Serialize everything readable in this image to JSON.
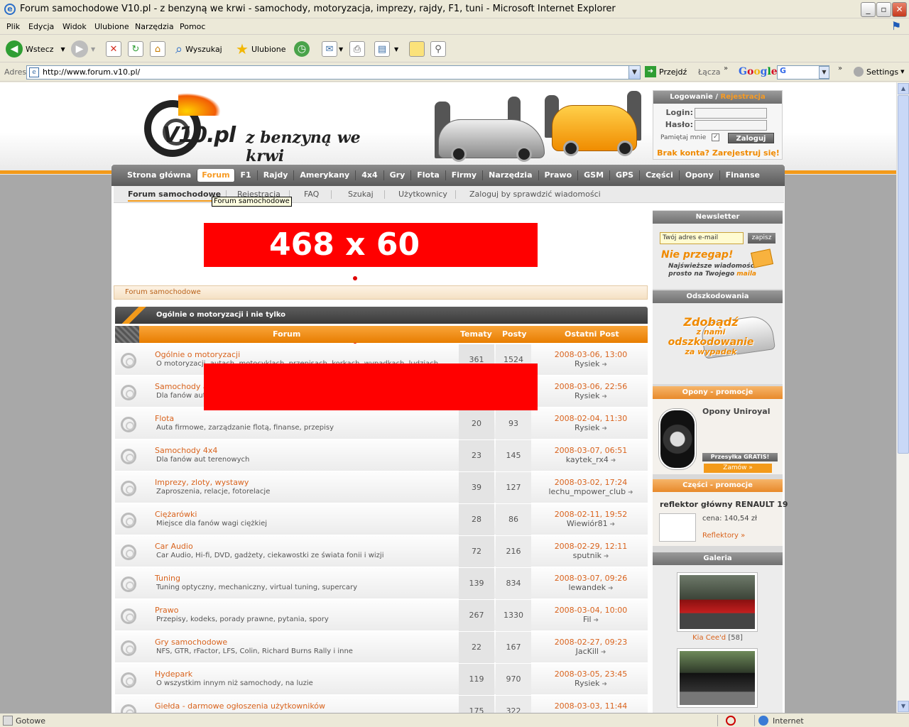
{
  "window": {
    "title": "Forum samochodowe V10.pl - z benzyną we krwi - samochody, motoryzacja, imprezy, rajdy, F1, tuni - Microsoft Internet Explorer",
    "min": "_",
    "max": "▫",
    "close": "✕"
  },
  "menu": [
    "Plik",
    "Edycja",
    "Widok",
    "Ulubione",
    "Narzędzia",
    "Pomoc"
  ],
  "toolbar": {
    "back": "Wstecz",
    "search": "Wyszukaj",
    "favorites": "Ulubione"
  },
  "address": {
    "label": "Adres",
    "url": "http://www.forum.v10.pl/",
    "go": "Przejdź",
    "links": "Łącza",
    "google": "Google",
    "google_box": "G",
    "settings": "Settings"
  },
  "header": {
    "brand": "V10.pl",
    "slogan": "z benzyną we krwi"
  },
  "login": {
    "title": "Logowanie",
    "sep": " / ",
    "register": "Rejestracja",
    "login_label": "Login:",
    "password_label": "Hasło:",
    "remember": "Pamiętaj mnie",
    "remember_checked": "✓",
    "submit": "Zaloguj",
    "no_account": "Brak konta? Zarejestruj się!"
  },
  "nav": {
    "active": "Forum",
    "items": [
      "Strona główna",
      "Forum",
      "F1",
      "Rajdy",
      "Amerykany",
      "4x4",
      "Gry",
      "Flota",
      "Firmy",
      "Narzędzia",
      "Prawo",
      "GSM",
      "GPS",
      "Części",
      "Opony",
      "Finanse"
    ]
  },
  "subnav": {
    "items": [
      "Forum samochodowe",
      "Rejestracja",
      "FAQ",
      "Szukaj",
      "Użytkownicy",
      "Zaloguj by sprawdzić wiadomości"
    ],
    "tooltip": "Forum samochodowe"
  },
  "banner": {
    "text": "468 x 60"
  },
  "breadcrumb": "Forum samochodowe",
  "category": "Ogólnie o motoryzacji i nie tylko",
  "table_headers": {
    "forum": "Forum",
    "topics": "Tematy",
    "posts": "Posty",
    "last": "Ostatni Post"
  },
  "forums": [
    {
      "name": "Ogólnie o motoryzacji",
      "desc": "O motoryzacji, autach, motocyklach, przepisach, korkach, wypadkach, ludziach",
      "topics": "361",
      "posts": "1524",
      "date": "2008-03-06, 13:00",
      "user": "Rysiek"
    },
    {
      "name": "Samochody amerykańskie",
      "desc": "Dla fanów aut amerykańskich",
      "topics": "",
      "posts": "",
      "date": "2008-03-06, 22:56",
      "user": "Rysiek"
    },
    {
      "name": "Flota",
      "desc": "Auta firmowe, zarządzanie flotą, finanse, przepisy",
      "topics": "20",
      "posts": "93",
      "date": "2008-02-04, 11:30",
      "user": "Rysiek"
    },
    {
      "name": "Samochody 4x4",
      "desc": "Dla fanów aut terenowych",
      "topics": "23",
      "posts": "145",
      "date": "2008-03-07, 06:51",
      "user": "kaytek_rx4"
    },
    {
      "name": "Imprezy, zloty, wystawy",
      "desc": "Zaproszenia, relacje, fotorelacje",
      "topics": "39",
      "posts": "127",
      "date": "2008-03-02, 17:24",
      "user": "lechu_mpower_club"
    },
    {
      "name": "Ciężarówki",
      "desc": "Miejsce dla fanów wagi ciężkiej",
      "topics": "28",
      "posts": "86",
      "date": "2008-02-11, 19:52",
      "user": "Wiewiór81"
    },
    {
      "name": "Car Audio",
      "desc": "Car Audio, Hi-fi, DVD, gadżety, ciekawostki ze świata fonii i wizji",
      "topics": "72",
      "posts": "216",
      "date": "2008-02-29, 12:11",
      "user": "sputnik"
    },
    {
      "name": "Tuning",
      "desc": "Tuning optyczny, mechaniczny, virtual tuning, supercary",
      "topics": "139",
      "posts": "834",
      "date": "2008-03-07, 09:26",
      "user": "lewandek"
    },
    {
      "name": "Prawo",
      "desc": "Przepisy, kodeks, porady prawne, pytania, spory",
      "topics": "267",
      "posts": "1330",
      "date": "2008-03-04, 10:00",
      "user": "Fil"
    },
    {
      "name": "Gry samochodowe",
      "desc": "NFS, GTR, rFactor, LFS, Colin, Richard Burns Rally i inne",
      "topics": "22",
      "posts": "167",
      "date": "2008-02-27, 09:23",
      "user": "JacKill"
    },
    {
      "name": "Hydepark",
      "desc": "O wszystkim innym niż samochody, na luzie",
      "topics": "119",
      "posts": "970",
      "date": "2008-03-05, 23:45",
      "user": "Rysiek"
    },
    {
      "name": "Giełda - darmowe ogłoszenia użytkowników",
      "desc": "",
      "topics": "175",
      "posts": "322",
      "date": "2008-03-03, 11:44",
      "user": ""
    }
  ],
  "sidebar": {
    "newsletter": {
      "title": "Newsletter",
      "placeholder": "Twój adres e-mail",
      "button": "zapisz",
      "big": "Nie przegap!",
      "line1": "Najświeższe wiadomości",
      "line2a": "prosto na Twojego ",
      "line2b": "maila"
    },
    "odszk": {
      "title": "Odszkodowania",
      "l1": "Zdobądź",
      "l2": "z nami",
      "l3": "odszkodowanie",
      "l4": "za wypadek"
    },
    "tires": {
      "title": "Opony - promocje",
      "name": "Opony Uniroyal",
      "badge": "Przesyłka GRATIS!",
      "order": "Zamów »"
    },
    "parts": {
      "title": "Części - promocje",
      "name": "reflektor główny RENAULT 19",
      "price": "cena: 140,54 zł",
      "link": "Reflektory »"
    },
    "gallery": {
      "title": "Galeria",
      "cap1": "Kia Cee'd",
      "cap1n": "[58]"
    }
  },
  "status": {
    "left": "Gotowe",
    "zone": "Internet"
  }
}
